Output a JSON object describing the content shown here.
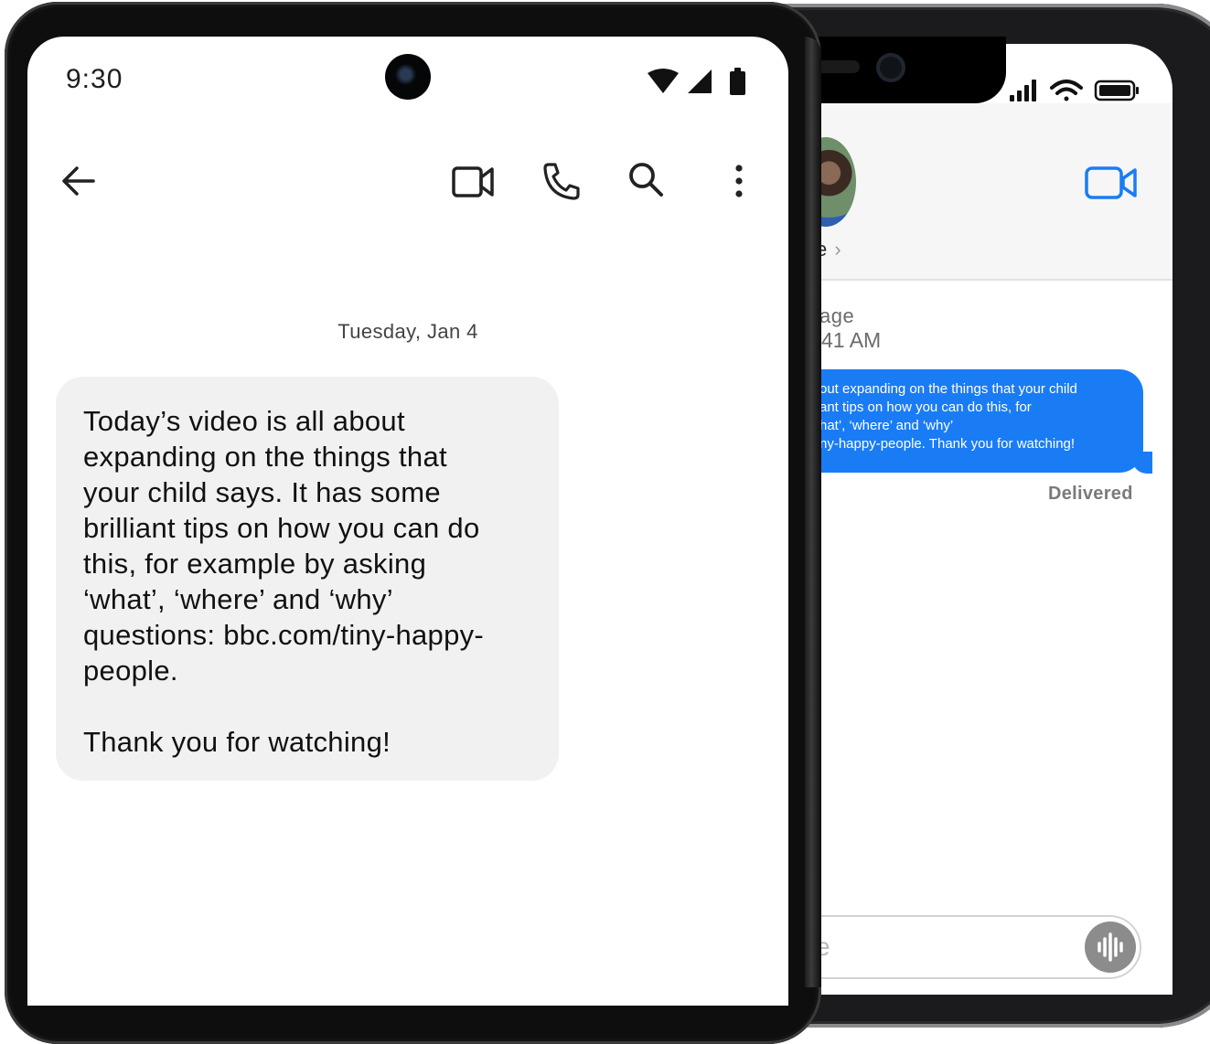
{
  "iphone": {
    "contact_name_fragment": "e",
    "chevron": "›",
    "label_line1": "age",
    "label_line2": "41 AM",
    "bubble_lines": [
      "out expanding on the things that your child",
      "ant tips on how you can do this, for",
      "hat’, ‘where’ and ‘why’",
      "ny-happy-people. Thank you for watching!"
    ],
    "delivered": "Delivered",
    "input_placeholder_fragment": "e",
    "colors": {
      "bubble": "#1a7cf5",
      "accent": "#1a7cf5"
    },
    "icons": [
      "signal-icon",
      "wifi-icon",
      "battery-icon",
      "video-call-icon",
      "audio-message-icon"
    ]
  },
  "android": {
    "status": {
      "time": "9:30"
    },
    "toolbar_icons": [
      "back-arrow-icon",
      "video-call-icon",
      "phone-icon",
      "search-icon",
      "more-vert-icon"
    ],
    "date_separator": "Tuesday, Jan 4",
    "message": {
      "lines": [
        "Today’s video is all about",
        "expanding on the things that",
        "your child says. It has some",
        "brilliant tips on how you can do",
        "this, for example by asking",
        "‘what’, ‘where’ and ‘why’",
        "questions: bbc.com/tiny-happy-",
        "people."
      ],
      "closing": "Thank you for watching!"
    },
    "colors": {
      "bubble": "#f1f1f1",
      "text": "#111111"
    }
  }
}
